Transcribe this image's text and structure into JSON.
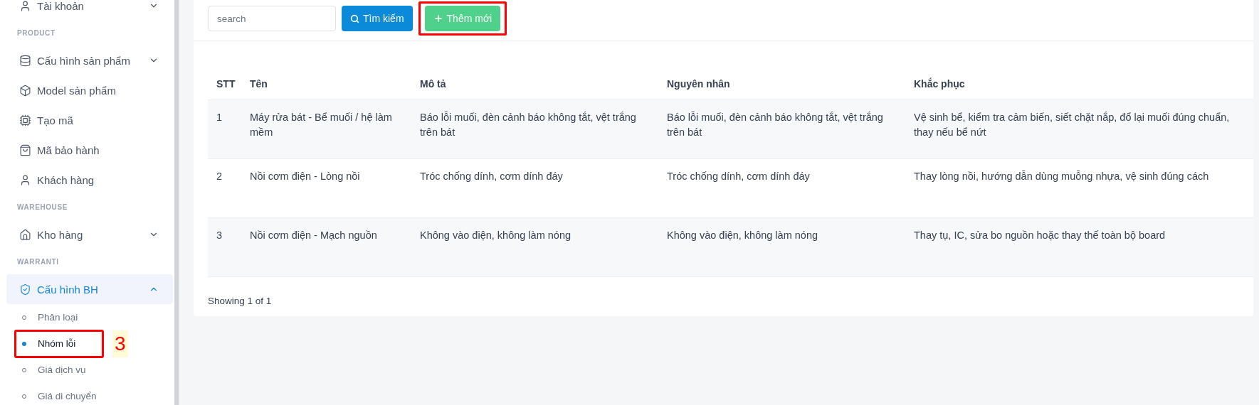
{
  "sidebar": {
    "items": [
      {
        "kind": "item",
        "label": "Tài khoản",
        "expanded": false,
        "selected": false
      },
      {
        "kind": "section",
        "label": "PRODUCT"
      },
      {
        "kind": "item",
        "label": "Cấu hình sản phẩm",
        "expanded": false,
        "selected": false
      },
      {
        "kind": "item",
        "label": "Model sản phẩm",
        "selected": false
      },
      {
        "kind": "item",
        "label": "Tạo mã",
        "selected": false
      },
      {
        "kind": "item",
        "label": "Mã bảo hành",
        "selected": false
      },
      {
        "kind": "item",
        "label": "Khách hàng",
        "selected": false
      },
      {
        "kind": "section",
        "label": "WAREHOUSE"
      },
      {
        "kind": "item",
        "label": "Kho hàng",
        "expanded": false,
        "selected": false
      },
      {
        "kind": "section",
        "label": "WARRANTI"
      },
      {
        "kind": "item",
        "label": "Cấu hình BH",
        "expanded": true,
        "selected": true
      },
      {
        "kind": "subitem",
        "label": "Phân loại",
        "selected": false,
        "annotated": false
      },
      {
        "kind": "subitem",
        "label": "Nhóm lỗi",
        "selected": true,
        "annotated": true,
        "annotation_label": "3"
      },
      {
        "kind": "subitem",
        "label": "Giá dịch vụ",
        "selected": false,
        "annotated": false
      },
      {
        "kind": "subitem",
        "label": "Giá di chuyển",
        "selected": false,
        "annotated": false
      }
    ]
  },
  "toolbar": {
    "search": {
      "placeholder": "search"
    },
    "search_button": {
      "label": "Tìm kiếm"
    },
    "add_button": {
      "label": "Thêm mới",
      "annotated": true
    }
  },
  "table": {
    "columns": [
      "STT",
      "Tên",
      "Mô tả",
      "Nguyên nhân",
      "Khắc phục"
    ],
    "rows": [
      [
        "1",
        "Máy rửa bát - Bể muối / hệ làm mềm",
        "Báo lỗi muối, đèn cảnh báo không tắt, vệt trắng trên bát",
        "Báo lỗi muối, đèn cảnh báo không tắt, vệt trắng trên bát",
        "Vệ sinh bể, kiểm tra cảm biến, siết chặt nắp, đổ lại muối đúng chuẩn, thay nếu bể nứt"
      ],
      [
        "2",
        "Nồi cơm điện - Lòng nồi",
        "Tróc chống dính, cơm dính đáy",
        "Tróc chống dính, cơm dính đáy",
        "Thay lòng nồi, hướng dẫn dùng muỗng nhựa, vệ sinh đúng cách"
      ],
      [
        "3",
        "Nồi cơm điện - Mạch nguồn",
        "Không vào điện, không làm nóng",
        "Không vào điện, không làm nóng",
        "Thay tụ, IC, sửa bo nguồn hoặc thay thế toàn bộ board"
      ]
    ]
  },
  "footer": {
    "summary": "Showing 1 of 1"
  }
}
